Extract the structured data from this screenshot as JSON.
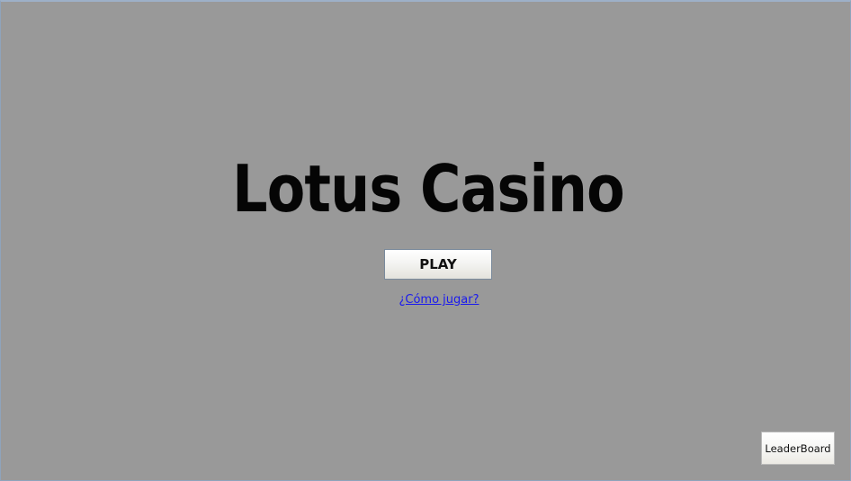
{
  "app": {
    "title": "Lotus Casino"
  },
  "menu": {
    "play_label": "PLAY",
    "how_to_play_label": "¿Cómo jugar?",
    "leaderboard_label": "LeaderBoard"
  },
  "colors": {
    "background": "#999999",
    "title_text": "#050505",
    "link": "#1a1aee"
  }
}
